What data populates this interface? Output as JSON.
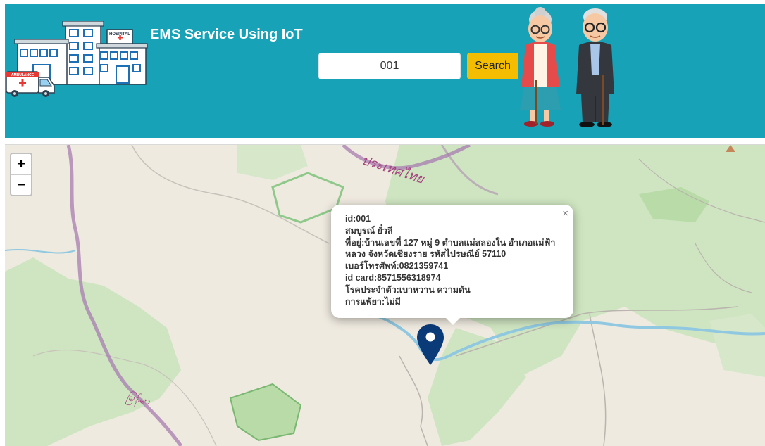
{
  "header": {
    "title": "EMS Service Using IoT",
    "hospital_sign": "HOSPITAL",
    "ambulance_sign": "AMBULANCE",
    "bg_color": "#18a2b8"
  },
  "search": {
    "value": "001",
    "button_label": "Search",
    "button_color": "#f5bd02"
  },
  "map": {
    "zoom_in": "+",
    "zoom_out": "−",
    "label_thailand": "ประเทศไทย",
    "label_myanmar": "မြန်မာ",
    "marker_color": "#0a3a78",
    "popup": {
      "close": "×",
      "id": "id:001",
      "name": "สมบูรณ์ ยั่วลี",
      "address": "ที่อยู่:บ้านเลขที่ 127 หมู่ 9 ตำบลแม่สลองใน อำเภอแม่ฟ้าหลวง จังหวัดเชียงราย รหัสไปรษณีย์ 57110",
      "phone": "เบอร์โทรศัพท์:0821359741",
      "id_card": "id card:8571556318974",
      "disease": "โรคประจำตัว:เบาหวาน ความดัน",
      "allergy": "การแพ้ยา:ไม่มี"
    }
  },
  "icons": [
    "hospital-illustration",
    "ambulance-icon",
    "elderly-couple-illustration",
    "map-marker-icon",
    "close-icon"
  ]
}
